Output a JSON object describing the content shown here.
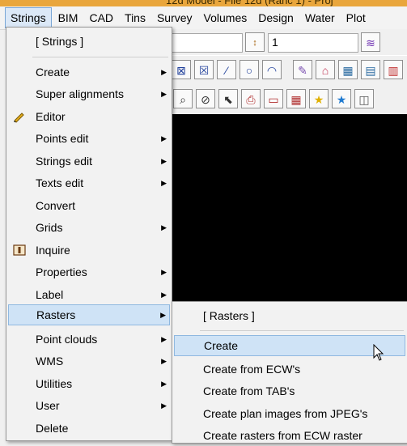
{
  "window": {
    "title_fragment": "12d Model - File 12d (Ranc 1) - Proj"
  },
  "menubar": {
    "items": [
      "Strings",
      "BIM",
      "CAD",
      "Tins",
      "Survey",
      "Volumes",
      "Design",
      "Water",
      "Plot"
    ]
  },
  "toolbar": {
    "combo_value": "1"
  },
  "strings_menu": {
    "header": "[ Strings ]",
    "items": [
      "Create",
      "Super alignments",
      "Editor",
      "Points edit",
      "Strings edit",
      "Texts edit",
      "Convert",
      "Grids",
      "Inquire",
      "Properties",
      "Label",
      "Rasters",
      "Point clouds",
      "WMS",
      "Utilities",
      "User",
      "Delete"
    ]
  },
  "rasters_menu": {
    "header": "[ Rasters ]",
    "items": [
      "Create",
      "Create from ECW's",
      "Create from TAB's",
      "Create plan images from JPEG's",
      "Create rasters from ECW raster"
    ]
  },
  "colors": {
    "highlight": "#cfe3f6",
    "highlight_border": "#8fb8e0",
    "canvas": "#000000"
  }
}
